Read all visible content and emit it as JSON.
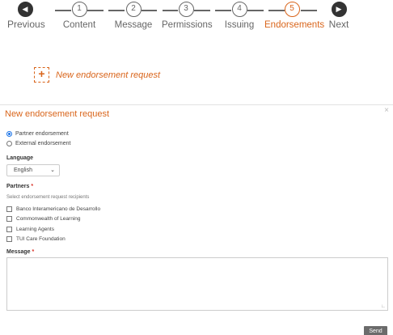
{
  "stepper": {
    "previous_label": "Previous",
    "next_label": "Next",
    "steps": [
      {
        "number": "1",
        "label": "Content",
        "active": false
      },
      {
        "number": "2",
        "label": "Message",
        "active": false
      },
      {
        "number": "3",
        "label": "Permissions",
        "active": false
      },
      {
        "number": "4",
        "label": "Issuing",
        "active": false
      },
      {
        "number": "5",
        "label": "Endorsements",
        "active": true
      }
    ],
    "accent_color": "#d9651b"
  },
  "new_request_tile": {
    "icon": "+",
    "label": "New endorsement request"
  },
  "form": {
    "title": "New endorsement request",
    "close": "×",
    "endorsement_types": [
      {
        "label": "Partner endorsement",
        "selected": true
      },
      {
        "label": "External endorsement",
        "selected": false
      }
    ],
    "language": {
      "label": "Language",
      "selected": "English"
    },
    "partners": {
      "label": "Partners",
      "required_mark": "*",
      "hint": "Select endorsement request recipients",
      "options": [
        {
          "label": "Banco Interamericano de Desarrollo",
          "checked": false
        },
        {
          "label": "Commonwealth of Learning",
          "checked": false
        },
        {
          "label": "Learning Agents",
          "checked": false
        },
        {
          "label": "TUI Care Foundation",
          "checked": false
        }
      ]
    },
    "message": {
      "label": "Message",
      "required_mark": "*",
      "value": ""
    },
    "send_label": "Send"
  }
}
